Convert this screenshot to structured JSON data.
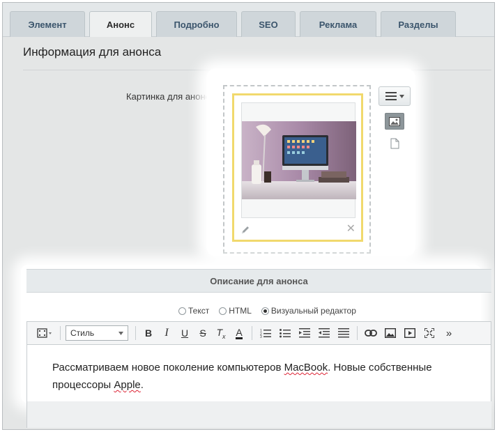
{
  "tabs": [
    {
      "label": "Элемент",
      "active": false
    },
    {
      "label": "Анонс",
      "active": true
    },
    {
      "label": "Подробно",
      "active": false
    },
    {
      "label": "SEO",
      "active": false
    },
    {
      "label": "Реклама",
      "active": false
    },
    {
      "label": "Разделы",
      "active": false
    }
  ],
  "section": {
    "title": "Информация для анонса",
    "picture_label": "Картинка для анонса:"
  },
  "description": {
    "header": "Описание для анонса",
    "modes": [
      {
        "label": "Текст",
        "selected": false
      },
      {
        "label": "HTML",
        "selected": false
      },
      {
        "label": "Визуальный редактор",
        "selected": true
      }
    ]
  },
  "editor": {
    "style_select": "Стиль",
    "toolbar_icons": [
      "film-icon",
      "bold-icon",
      "italic-icon",
      "underline-icon",
      "strikethrough-icon",
      "clear-format-icon",
      "font-color-icon",
      "ordered-list-icon",
      "unordered-list-icon",
      "indent-icon",
      "outdent-icon",
      "align-icon",
      "link-icon",
      "image-icon",
      "video-icon",
      "fullscreen-icon",
      "more-icon"
    ],
    "text_parts": [
      "Рассматриваем новое поколение компьютеров ",
      "MacBook",
      ". Новые собственные процессоры ",
      "Apple",
      "."
    ]
  },
  "colors": {
    "accent_border": "#f1d96d",
    "tab_text": "#3b556c"
  }
}
